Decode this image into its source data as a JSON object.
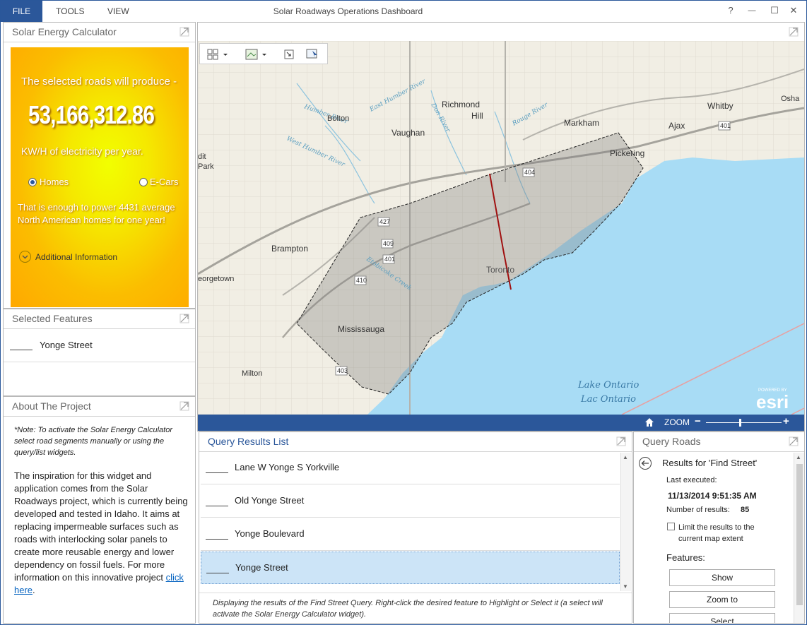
{
  "window": {
    "title": "Solar Roadways Operations Dashboard",
    "menu": [
      "FILE",
      "TOOLS",
      "VIEW"
    ],
    "controls": {
      "help": "?",
      "minimize": "—",
      "maximize": "☐",
      "close": "✕"
    }
  },
  "solar_calc": {
    "header": "Solar Energy Calculator",
    "intro": "The selected roads will produce -",
    "value": "53,166,312.86",
    "unit": "KW/H of electricity per year.",
    "options": [
      {
        "label": "Homes",
        "selected": true
      },
      {
        "label": "E-Cars",
        "selected": false
      }
    ],
    "summary": "That is enough to power 4431 average North American homes for one year!",
    "additional": "Additional Information"
  },
  "selected_features": {
    "header": "Selected Features",
    "items": [
      "Yonge Street"
    ]
  },
  "about": {
    "header": "About The Project",
    "note": "*Note: To activate the Solar Energy Calculator select road segments manually or using the query/list widgets.",
    "body": "The inspiration for this widget and application comes from the Solar Roadways project, which is currently being developed and tested in Idaho. It aims at replacing impermeable surfaces such as roads with interlocking solar panels to create more reusable energy and lower dependency on fossil fuels. For more information on this innovative project ",
    "link": "click here",
    "end": "."
  },
  "map": {
    "places": [
      "Bolton",
      "Richmond Hill",
      "Vaughan",
      "Markham",
      "Whitby",
      "Ajax",
      "Pickering",
      "Brampton",
      "Georgetown",
      "Toronto",
      "Mississauga",
      "Milton",
      "Lake Ontario",
      "Lac Ontario",
      "Oshawa"
    ],
    "place_labels": {
      "bolton": "Bolton",
      "richmond": "Richmond",
      "hill": "Hill",
      "vaughan": "Vaughan",
      "markham": "Markham",
      "whitby": "Whitby",
      "ajax": "Ajax",
      "pickering": "Pickering",
      "brampton": "Brampton",
      "georgetown": "eorgetown",
      "toronto": "Toronto",
      "mississauga": "Mississauga",
      "milton": "Milton",
      "lake_en": "Lake Ontario",
      "lake_fr": "Lac Ontario",
      "oshawa": "Osha",
      "halton": "dit",
      "park": "Park"
    },
    "highways": [
      "427",
      "409",
      "401",
      "410",
      "404",
      "403",
      "401"
    ],
    "rivers": [
      "East Humber River",
      "Humber River",
      "West Humber River",
      "Rouge River",
      "Don River",
      "Etobicoke Creek"
    ],
    "logo_small": "POWERED BY",
    "logo": "esri"
  },
  "zoom": {
    "label": "ZOOM",
    "minus": "−",
    "plus": "+",
    "level": 0.45
  },
  "query_results": {
    "header": "Query Results List",
    "items": [
      {
        "label": "Lane W Yonge S Yorkville",
        "selected": false
      },
      {
        "label": "Old Yonge Street",
        "selected": false
      },
      {
        "label": "Yonge Boulevard",
        "selected": false
      },
      {
        "label": "Yonge Street",
        "selected": true
      }
    ],
    "footer": "Displaying the results of the Find Street Query. Right-click the desired feature to Highlight or Select it (a select will activate the Solar Energy Calculator widget)."
  },
  "query_roads": {
    "header": "Query Roads",
    "results_title": "Results for 'Find Street'",
    "last_executed_label": "Last executed:",
    "last_executed": "11/13/2014 9:51:35 AM",
    "count_label": "Number of results:",
    "count": "85",
    "limit_label": "Limit the results to the current map extent",
    "features_label": "Features:",
    "buttons": {
      "show": "Show",
      "zoom": "Zoom to",
      "select": "Select"
    }
  },
  "colors": {
    "accent": "#2b579a",
    "selected_row": "#cce4f7",
    "road_highlight": "#a01010",
    "water": "#a8dcf5"
  }
}
